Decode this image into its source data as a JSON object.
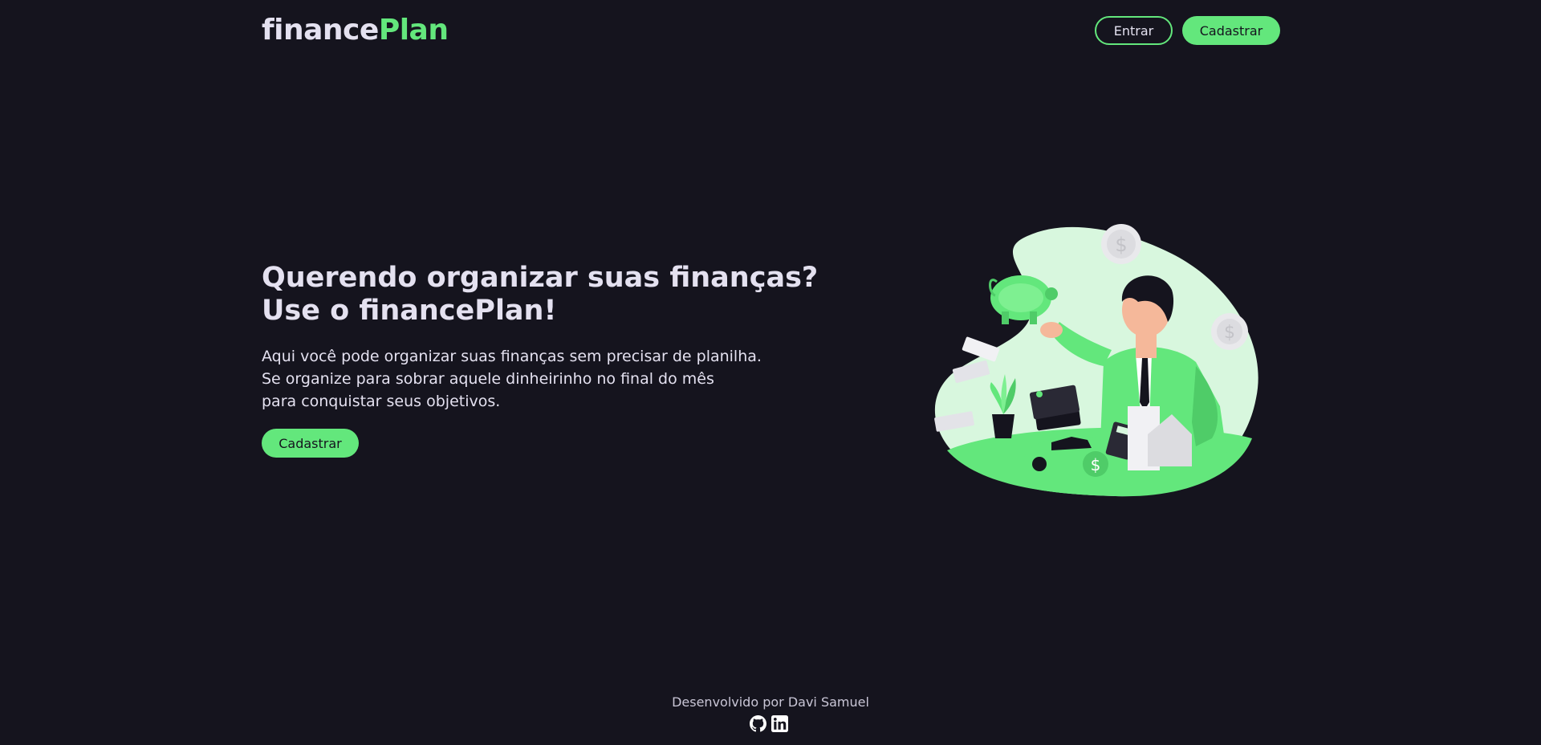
{
  "header": {
    "logo_part1": "finance",
    "logo_part2": "Plan",
    "login_label": "Entrar",
    "signup_label": "Cadastrar"
  },
  "hero": {
    "title_line1": "Querendo organizar suas finanças?",
    "title_line2": "Use o financePlan!",
    "text_line1": "Aqui você pode organizar suas finanças sem precisar de planilha.",
    "text_line2": "Se organize para sobrar aquele dinheirinho no final do mês",
    "text_line3": "para conquistar seus objetivos.",
    "cta_label": "Cadastrar"
  },
  "footer": {
    "credit": "Desenvolvido por Davi Samuel",
    "icons": [
      "github-icon",
      "linkedin-icon"
    ]
  },
  "colors": {
    "background": "#15141e",
    "accent": "#63e77c",
    "text": "#e4e1f0"
  }
}
